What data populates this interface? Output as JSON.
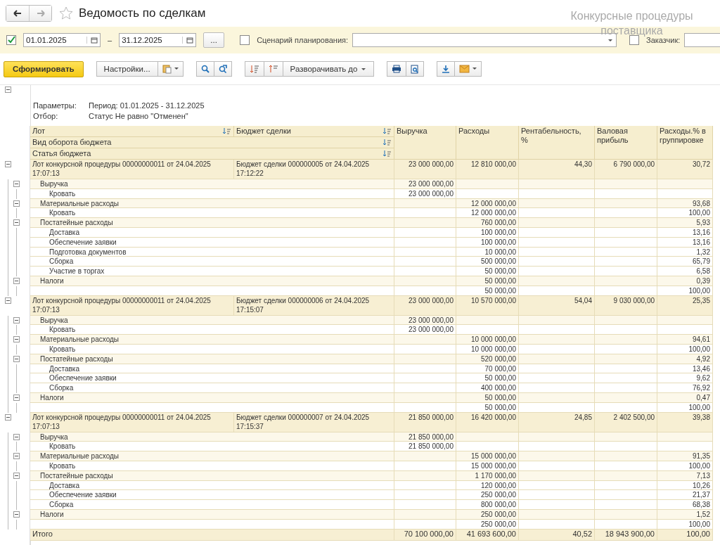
{
  "window": {
    "title": "Ведомость по сделкам",
    "section_hint": "Конкурсные процедуры поставщика"
  },
  "filters": {
    "period_enabled": true,
    "date_from": "01.01.2025",
    "date_separator": "–",
    "date_to": "31.12.2025",
    "period_button": "...",
    "scenario": {
      "checked": false,
      "label": "Сценарий планирования:"
    },
    "customer": {
      "checked": false,
      "label": "Заказчик:"
    }
  },
  "toolbar": {
    "generate": "Сформировать",
    "settings": "Настройки...",
    "expand_to": "Разворачивать до"
  },
  "report": {
    "parameters_label": "Параметры:",
    "parameters_value": "Период: 01.01.2025 - 31.12.2025",
    "filter_label": "Отбор:",
    "filter_value": "Статус Не равно \"Отменен\"",
    "header": {
      "lot": "Лот",
      "budget": "Бюджет сделки",
      "turnover_type": "Вид оборота бюджета",
      "budget_item": "Статья бюджета",
      "revenue": "Выручка",
      "expenses": "Расходы",
      "profitability": "Рентабельность, %",
      "gross_profit": "Валовая прибыль",
      "expense_share": "Расходы.% в группировке"
    },
    "groups": [
      {
        "expanded": true,
        "lot": "Лот конкурсной процедуры 00000000011 от 24.04.2025 17:07:13",
        "budget": "Бюджет сделки 000000005 от 24.04.2025 17:12:22",
        "values": {
          "revenue": "23 000 000,00",
          "expenses": "12 810 000,00",
          "profitability": "44,30",
          "gross_profit": "6 790 000,00",
          "expense_share": "30,72"
        },
        "sections": [
          {
            "name": "Выручка",
            "expanded": true,
            "values": {
              "revenue": "23 000 000,00"
            },
            "items": [
              {
                "name": "Кровать",
                "values": {
                  "revenue": "23 000 000,00"
                }
              }
            ]
          },
          {
            "name": "Материальные расходы",
            "expanded": true,
            "values": {
              "expenses": "12 000 000,00",
              "expense_share": "93,68"
            },
            "items": [
              {
                "name": "Кровать",
                "values": {
                  "expenses": "12 000 000,00",
                  "expense_share": "100,00"
                }
              }
            ]
          },
          {
            "name": "Постатейные расходы",
            "expanded": true,
            "values": {
              "expenses": "760 000,00",
              "expense_share": "5,93"
            },
            "items": [
              {
                "name": "Доставка",
                "values": {
                  "expenses": "100 000,00",
                  "expense_share": "13,16"
                }
              },
              {
                "name": "Обеспечение заявки",
                "values": {
                  "expenses": "100 000,00",
                  "expense_share": "13,16"
                }
              },
              {
                "name": "Подготовка документов",
                "values": {
                  "expenses": "10 000,00",
                  "expense_share": "1,32"
                }
              },
              {
                "name": "Сборка",
                "values": {
                  "expenses": "500 000,00",
                  "expense_share": "65,79"
                }
              },
              {
                "name": "Участие в торгах",
                "values": {
                  "expenses": "50 000,00",
                  "expense_share": "6,58"
                }
              }
            ]
          },
          {
            "name": "Налоги",
            "expanded": true,
            "values": {
              "expenses": "50 000,00",
              "expense_share": "0,39"
            },
            "items": [
              {
                "values": {
                  "expenses": "50 000,00",
                  "expense_share": "100,00"
                }
              }
            ]
          }
        ]
      },
      {
        "expanded": true,
        "lot": "Лот конкурсной процедуры 00000000011 от 24.04.2025 17:07:13",
        "budget": "Бюджет сделки 000000006 от 24.04.2025 17:15:07",
        "values": {
          "revenue": "23 000 000,00",
          "expenses": "10 570 000,00",
          "profitability": "54,04",
          "gross_profit": "9 030 000,00",
          "expense_share": "25,35"
        },
        "sections": [
          {
            "name": "Выручка",
            "expanded": true,
            "values": {
              "revenue": "23 000 000,00"
            },
            "items": [
              {
                "name": "Кровать",
                "values": {
                  "revenue": "23 000 000,00"
                }
              }
            ]
          },
          {
            "name": "Материальные расходы",
            "expanded": true,
            "values": {
              "expenses": "10 000 000,00",
              "expense_share": "94,61"
            },
            "items": [
              {
                "name": "Кровать",
                "values": {
                  "expenses": "10 000 000,00",
                  "expense_share": "100,00"
                }
              }
            ]
          },
          {
            "name": "Постатейные расходы",
            "expanded": true,
            "values": {
              "expenses": "520 000,00",
              "expense_share": "4,92"
            },
            "items": [
              {
                "name": "Доставка",
                "values": {
                  "expenses": "70 000,00",
                  "expense_share": "13,46"
                }
              },
              {
                "name": "Обеспечение заявки",
                "values": {
                  "expenses": "50 000,00",
                  "expense_share": "9,62"
                }
              },
              {
                "name": "Сборка",
                "values": {
                  "expenses": "400 000,00",
                  "expense_share": "76,92"
                }
              }
            ]
          },
          {
            "name": "Налоги",
            "expanded": true,
            "values": {
              "expenses": "50 000,00",
              "expense_share": "0,47"
            },
            "items": [
              {
                "values": {
                  "expenses": "50 000,00",
                  "expense_share": "100,00"
                }
              }
            ]
          }
        ]
      },
      {
        "expanded": true,
        "lot": "Лот конкурсной процедуры 00000000011 от 24.04.2025 17:07:13",
        "budget": "Бюджет сделки 000000007 от 24.04.2025 17:15:37",
        "values": {
          "revenue": "21 850 000,00",
          "expenses": "16 420 000,00",
          "profitability": "24,85",
          "gross_profit": "2 402 500,00",
          "expense_share": "39,38"
        },
        "sections": [
          {
            "name": "Выручка",
            "expanded": true,
            "values": {
              "revenue": "21 850 000,00"
            },
            "items": [
              {
                "name": "Кровать",
                "values": {
                  "revenue": "21 850 000,00"
                }
              }
            ]
          },
          {
            "name": "Материальные расходы",
            "expanded": true,
            "values": {
              "expenses": "15 000 000,00",
              "expense_share": "91,35"
            },
            "items": [
              {
                "name": "Кровать",
                "values": {
                  "expenses": "15 000 000,00",
                  "expense_share": "100,00"
                }
              }
            ]
          },
          {
            "name": "Постатейные расходы",
            "expanded": true,
            "values": {
              "expenses": "1 170 000,00",
              "expense_share": "7,13"
            },
            "items": [
              {
                "name": "Доставка",
                "values": {
                  "expenses": "120 000,00",
                  "expense_share": "10,26"
                }
              },
              {
                "name": "Обеспечение заявки",
                "values": {
                  "expenses": "250 000,00",
                  "expense_share": "21,37"
                }
              },
              {
                "name": "Сборка",
                "values": {
                  "expenses": "800 000,00",
                  "expense_share": "68,38"
                }
              }
            ]
          },
          {
            "name": "Налоги",
            "expanded": true,
            "values": {
              "expenses": "250 000,00",
              "expense_share": "1,52"
            },
            "items": [
              {
                "values": {
                  "expenses": "250 000,00",
                  "expense_share": "100,00"
                }
              }
            ]
          }
        ]
      }
    ],
    "total": {
      "label": "Итого",
      "values": {
        "revenue": "70 100 000,00",
        "expenses": "41 693 600,00",
        "profitability": "40,52",
        "gross_profit": "18 943 900,00",
        "expense_share": "100,00"
      }
    }
  }
}
